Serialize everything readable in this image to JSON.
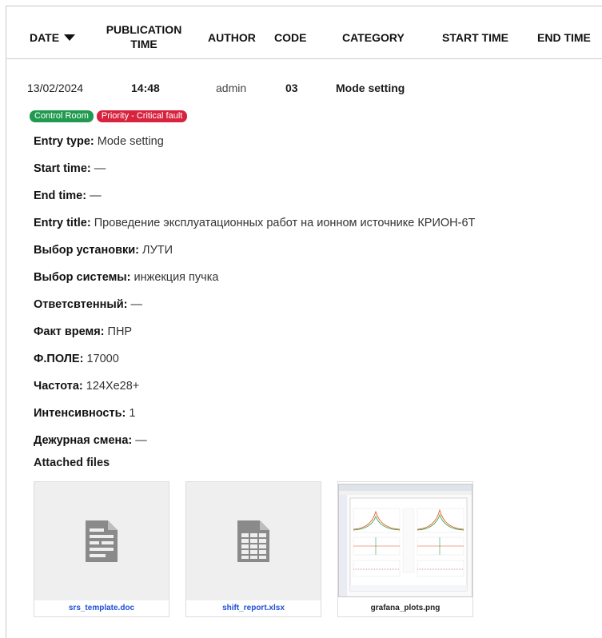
{
  "table": {
    "headers": {
      "date": "DATE",
      "publication_time": "PUBLICATION TIME",
      "author": "AUTHOR",
      "code": "CODE",
      "category": "CATEGORY",
      "start_time": "START TIME",
      "end_time": "END TIME"
    },
    "row": {
      "date": "13/02/2024",
      "publication_time": "14:48",
      "author": "admin",
      "code": "03",
      "category": "Mode setting"
    }
  },
  "badges": {
    "control_room": "Control Room",
    "priority": "Priority - Critical fault"
  },
  "details": [
    {
      "label": "Entry type:",
      "value": "Mode setting"
    },
    {
      "label": "Start time:",
      "value": "—"
    },
    {
      "label": "End time:",
      "value": "—"
    },
    {
      "label": "Entry title:",
      "value": "Проведение эксплуатационных работ на ионном источнике КРИОН-6Т"
    },
    {
      "label": "Выбор установки:",
      "value": "ЛУТИ"
    },
    {
      "label": "Выбор системы:",
      "value": "инжекция пучка"
    },
    {
      "label": "Ответсвтенный:",
      "value": "—"
    },
    {
      "label": "Факт время:",
      "value": "ПНР"
    },
    {
      "label": "Ф.ПОЛЕ:",
      "value": "17000"
    },
    {
      "label": "Частота:",
      "value": "124Xe28+"
    },
    {
      "label": "Интенсивность:",
      "value": "1"
    },
    {
      "label": "Дежурная смена:",
      "value": "—"
    }
  ],
  "attachments": {
    "title": "Attached files",
    "files": [
      {
        "name": "srs_template.doc",
        "icon": "document-icon"
      },
      {
        "name": "shift_report.xlsx",
        "icon": "spreadsheet-icon"
      },
      {
        "name": "grafana_plots.png",
        "icon": "image-preview"
      }
    ]
  },
  "colors": {
    "badge_green": "#1f9a4e",
    "badge_red": "#d8233f",
    "link": "#1f4fd6"
  }
}
